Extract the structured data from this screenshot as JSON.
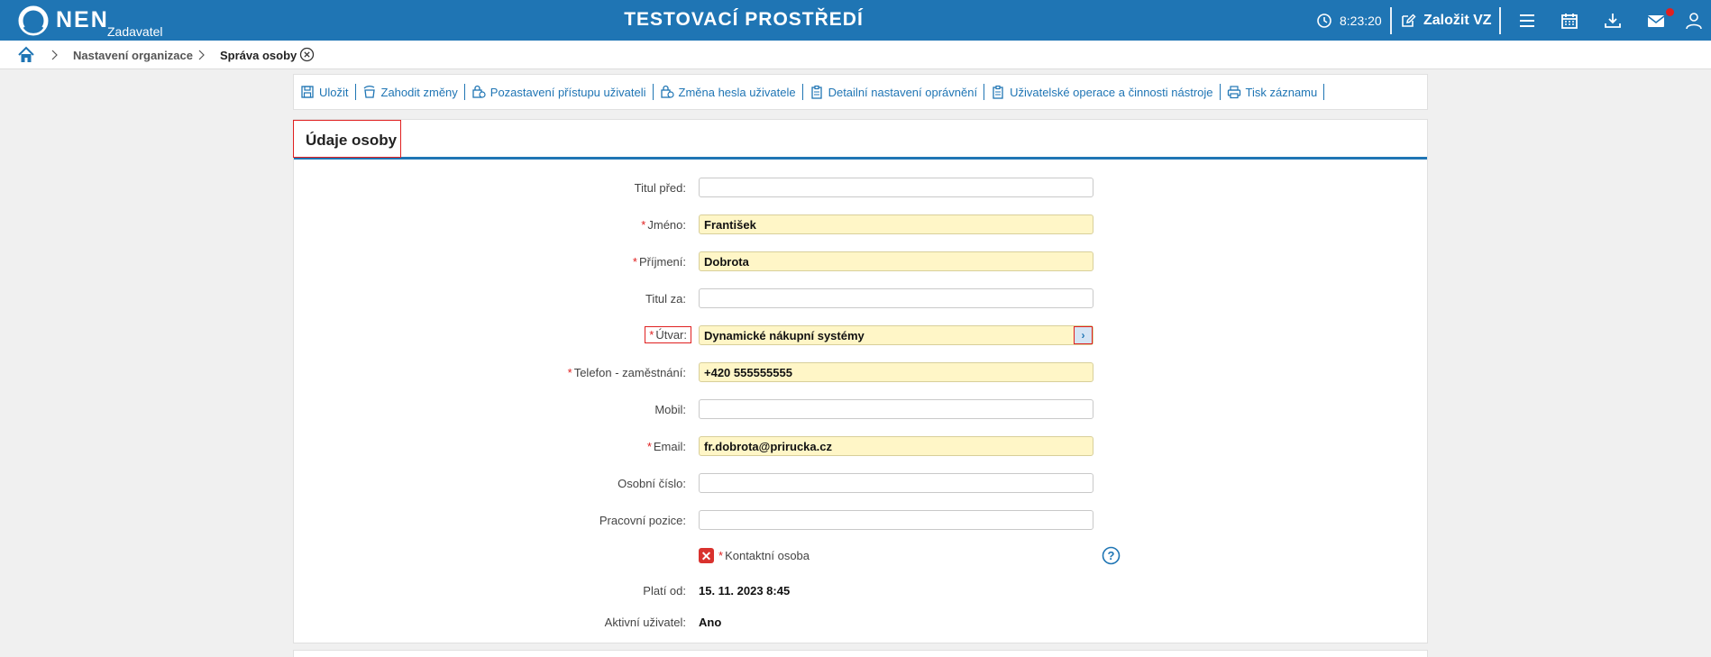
{
  "header": {
    "logo_text": "NEN",
    "logo_sub": "Zadavatel",
    "env_title": "TESTOVACÍ PROSTŘEDÍ",
    "time": "8:23:20",
    "create_label": "Založit VZ",
    "icons": [
      "clock-icon",
      "edit-icon",
      "menu-icon",
      "calendar-icon",
      "download-icon",
      "mail-icon",
      "user-icon"
    ],
    "accent_color": "#1f75b4",
    "notification_color": "#e02020"
  },
  "breadcrumb": {
    "items": [
      "Nastavení organizace",
      "Správa osoby"
    ]
  },
  "toolbar": {
    "actions": [
      {
        "label": "Uložit",
        "icon": "save-icon"
      },
      {
        "label": "Zahodit změny",
        "icon": "discard-icon"
      },
      {
        "label": "Pozastavení přístupu uživateli",
        "icon": "suspend-access-icon"
      },
      {
        "label": "Změna hesla uživatele",
        "icon": "password-change-icon"
      },
      {
        "label": "Detailní nastavení oprávnění",
        "icon": "permissions-icon"
      },
      {
        "label": "Uživatelské operace a činnosti nástroje",
        "icon": "operations-icon"
      },
      {
        "label": "Tisk záznamu",
        "icon": "print-icon"
      }
    ]
  },
  "form": {
    "title": "Údaje osoby",
    "fields": {
      "titul_pred": {
        "label": "Titul před:",
        "value": ""
      },
      "jmeno": {
        "label": "Jméno:",
        "value": "František"
      },
      "prijmeni": {
        "label": "Příjmení:",
        "value": "Dobrota"
      },
      "titul_za": {
        "label": "Titul za:",
        "value": ""
      },
      "utvar": {
        "label": "Útvar:",
        "value": "Dynamické nákupní systémy"
      },
      "telefon": {
        "label": "Telefon - zaměstnání:",
        "value": "+420 555555555"
      },
      "mobil": {
        "label": "Mobil:",
        "value": ""
      },
      "email": {
        "label": "Email:",
        "value": "fr.dobrota@prirucka.cz"
      },
      "osobni_cislo": {
        "label": "Osobní číslo:",
        "value": ""
      },
      "pracovni_pozice": {
        "label": "Pracovní pozice:",
        "value": ""
      }
    },
    "kontaktni_osoba": {
      "label": "Kontaktní osoba",
      "checked": false
    },
    "plati_od": {
      "label": "Platí od:",
      "value": "15. 11. 2023 8:45"
    },
    "aktivni": {
      "label": "Aktivní uživatel:",
      "value": "Ano"
    },
    "required_marker": "*",
    "lookup_symbol": "›",
    "unchecked_symbol": "✕"
  }
}
